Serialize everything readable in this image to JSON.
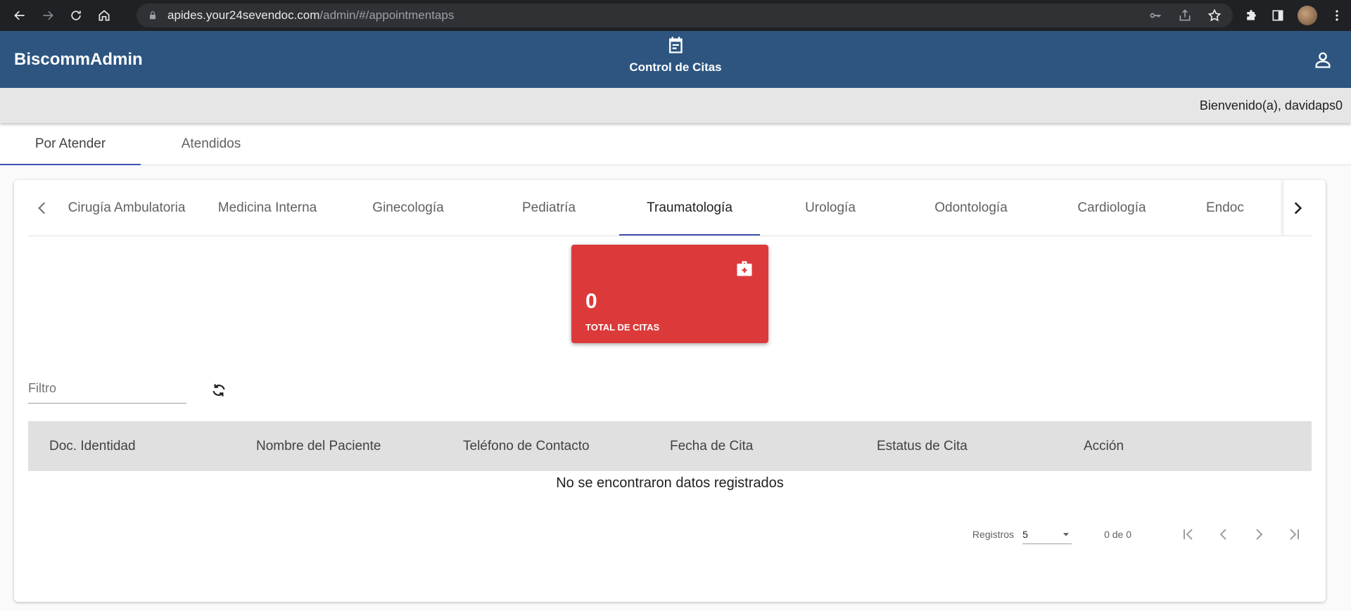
{
  "browser": {
    "url_host": "apides.your24sevendoc.com",
    "url_path": "/admin/#/appointmentaps"
  },
  "app": {
    "brand": "BiscommAdmin",
    "section_title": "Control de Citas",
    "welcome": "Bienvenido(a), davidaps0"
  },
  "main_tabs": [
    {
      "label": "Por Atender"
    },
    {
      "label": "Atendidos"
    }
  ],
  "specialty_tabs": [
    {
      "label": "Cirugía Ambulatoria"
    },
    {
      "label": "Medicina Interna"
    },
    {
      "label": "Ginecología"
    },
    {
      "label": "Pediatría"
    },
    {
      "label": "Traumatología"
    },
    {
      "label": "Urología"
    },
    {
      "label": "Odontología"
    },
    {
      "label": "Cardiología"
    },
    {
      "label": "Endoc"
    }
  ],
  "active_specialty": "Traumatología",
  "stat": {
    "value": "0",
    "label": "TOTAL DE CITAS",
    "color": "#dc3a3a"
  },
  "filter": {
    "placeholder": "Filtro"
  },
  "table": {
    "columns": [
      "Doc. Identidad",
      "Nombre del Paciente",
      "Teléfono de Contacto",
      "Fecha de Cita",
      "Estatus de Cita",
      "Acción"
    ],
    "empty_message": "No se encontraron datos registrados"
  },
  "paginator": {
    "label": "Registros",
    "page_size": "5",
    "range": "0 de 0"
  },
  "colors": {
    "appbar": "#2d5580",
    "accent": "#3f51b5"
  }
}
